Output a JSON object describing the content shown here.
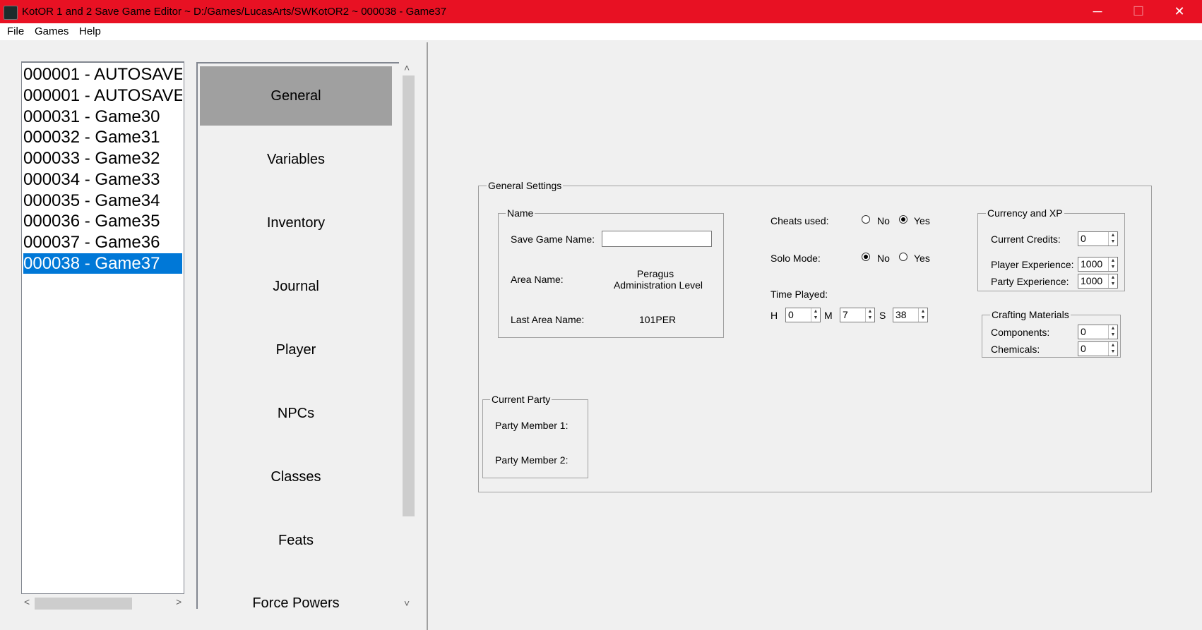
{
  "window": {
    "title": "KotOR 1 and 2 Save Game Editor ~ D:/Games/LucasArts/SWKotOR2 ~ 000038 - Game37",
    "minimize": "─",
    "maximize": "☐",
    "close": "✕"
  },
  "menu": {
    "file": "File",
    "games": "Games",
    "help": "Help"
  },
  "save_list": {
    "items": [
      "000001 - AUTOSAVE",
      "000001 - AUTOSAVE",
      "000031 - Game30",
      "000032 - Game31",
      "000033 - Game32",
      "000034 - Game33",
      "000035 - Game34",
      "000036 - Game35",
      "000037 - Game36",
      "000038 - Game37"
    ],
    "selected_index": 9,
    "scroll_left": "<",
    "scroll_right": ">"
  },
  "nav": {
    "items": [
      "General",
      "Variables",
      "Inventory",
      "Journal",
      "Player",
      "NPCs",
      "Classes",
      "Feats",
      "Force Powers"
    ],
    "active_index": 0,
    "scroll_up": "˄",
    "scroll_down": "˅"
  },
  "general_settings": {
    "legend": "General Settings",
    "name_group": {
      "legend": "Name",
      "save_game_name_label": "Save Game Name:",
      "save_game_name_value": "",
      "area_name_label": "Area Name:",
      "area_name_line1": "Peragus",
      "area_name_line2": "Administration Level",
      "last_area_name_label": "Last Area Name:",
      "last_area_name_value": "101PER"
    },
    "cheats_used": {
      "label": "Cheats used:",
      "no": "No",
      "yes": "Yes",
      "selected": "Yes"
    },
    "solo_mode": {
      "label": "Solo Mode:",
      "no": "No",
      "yes": "Yes",
      "selected": "No"
    },
    "time_played": {
      "label": "Time Played:",
      "h_label": "H",
      "h_value": "0",
      "m_label": "M",
      "m_value": "7",
      "s_label": "S",
      "s_value": "38"
    },
    "currency_xp": {
      "legend": "Currency and XP",
      "credits_label": "Current Credits:",
      "credits_value": "0",
      "player_xp_label": "Player Experience:",
      "player_xp_value": "1000",
      "party_xp_label": "Party Experience:",
      "party_xp_value": "1000"
    },
    "crafting": {
      "legend": "Crafting Materials",
      "components_label": "Components:",
      "components_value": "0",
      "chemicals_label": "Chemicals:",
      "chemicals_value": "0"
    },
    "current_party": {
      "legend": "Current Party",
      "member1_label": "Party Member 1:",
      "member2_label": "Party Member 2:"
    }
  },
  "colors": {
    "title_bar": "#e81123",
    "selection": "#0078d7",
    "active_nav": "#a0a0a0"
  }
}
